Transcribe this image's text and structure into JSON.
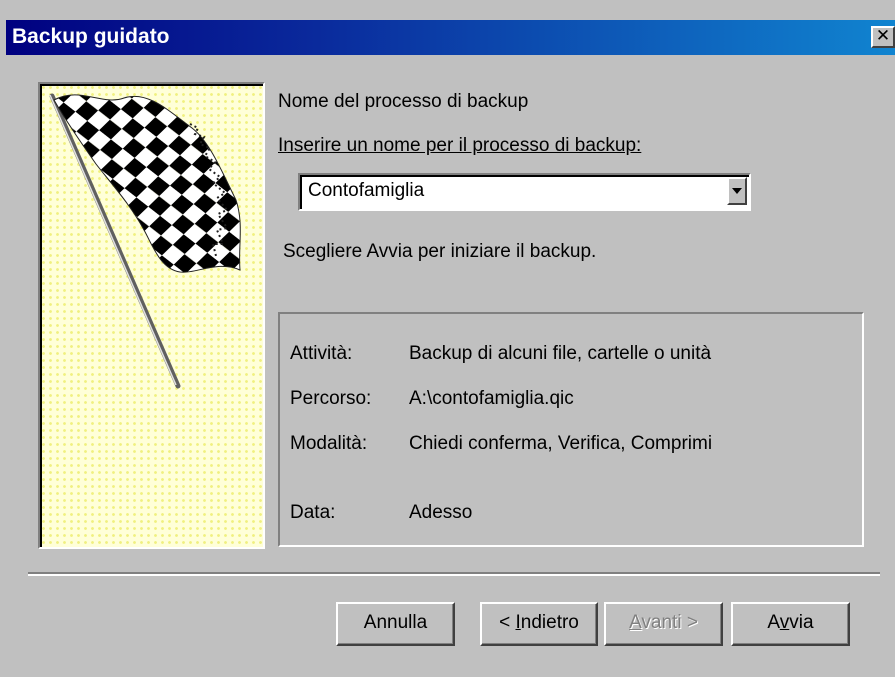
{
  "window": {
    "title": "Backup guidato",
    "close_glyph": "✕"
  },
  "header": {
    "section_title": "Nome del processo di backup",
    "prompt_label": "Inserire un nome per il processo di backup:"
  },
  "job_name_combo": {
    "value": "Contofamiglia"
  },
  "instruction": "Scegliere Avvia per iniziare il backup.",
  "summary": {
    "rows": [
      {
        "key": "Attività:",
        "value": "Backup di alcuni file, cartelle o unità"
      },
      {
        "key": "Percorso:",
        "value": "A:\\contofamiglia.qic"
      },
      {
        "key": "Modalità:",
        "value": "Chiedi conferma, Verifica, Comprimi"
      },
      {
        "key": "Data:",
        "value": "Adesso"
      }
    ]
  },
  "buttons": {
    "cancel": "Annulla",
    "back_prefix": "< ",
    "back_mnemonic": "I",
    "back_rest": "ndietro",
    "next_mnemonic": "A",
    "next_rest": "vanti >",
    "start_prefix": "A",
    "start_mnemonic": "v",
    "start_rest": "via"
  },
  "colors": {
    "titlebar_start": "#000080",
    "titlebar_end": "#1084d0",
    "face": "#c0c0c0",
    "flag_background": "#ffffd8"
  },
  "icons": {
    "flag": "checkered-flag-icon",
    "close": "close-icon",
    "dropdown": "chevron-down-icon"
  }
}
